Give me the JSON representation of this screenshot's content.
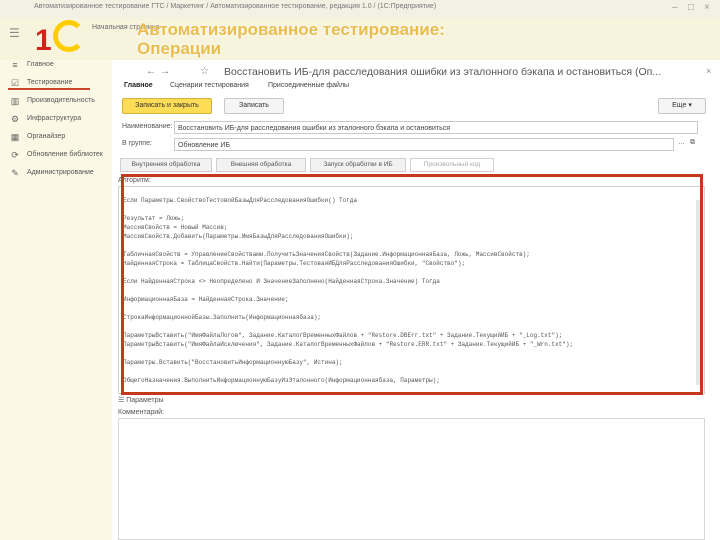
{
  "window": {
    "title": "Автоматизированное тестирование ГТС / Маркетинг / Автоматизированное тестирование, редакция 1.0 / (1С:Предприятие)"
  },
  "header": {
    "breadcrumb": "Начальная страница",
    "overlay_title_line1": "Автоматизированное тестирование:",
    "overlay_title_line2": "Операции"
  },
  "sidebar": {
    "items": [
      {
        "label": "Главное",
        "icon": "list-icon"
      },
      {
        "label": "Тестирование",
        "icon": "checklist-icon"
      },
      {
        "label": "Производительность",
        "icon": "chart-icon"
      },
      {
        "label": "Инфраструктура",
        "icon": "gear-icon"
      },
      {
        "label": "Органайзер",
        "icon": "calendar-icon"
      },
      {
        "label": "Обновление библиотек",
        "icon": "refresh-icon"
      },
      {
        "label": "Администрирование",
        "icon": "wrench-icon"
      }
    ]
  },
  "form": {
    "title": "Восстановить ИБ-для расследования ошибки из эталонного бэкапа и остановиться (Оп...",
    "tabs": [
      "Главное",
      "Сценарии тестирования",
      "Присоединенные файлы"
    ],
    "save_close_label": "Записать и закрыть",
    "save_label": "Записать",
    "more_label": "Еще",
    "name_label": "Наименование:",
    "name_value": "Восстановить ИБ-для расследования ошибки из эталонного бэкапа и остановиться",
    "group_label": "В группе:",
    "group_value": "Обновление ИБ",
    "subtabs": [
      "Внутренняя обработка",
      "Внешняя обработка",
      "Запуск обработки в ИБ",
      "Произвольный код"
    ],
    "algorithm_label": "Алгоритм:",
    "code_lines": [
      "Если Параметры.СвойствоТестовойБазыДляРасследованияОшибки() Тогда",
      "",
      "    Результат = Ложь;",
      "    МассивСвойств = Новый Массив;",
      "    МассивСвойств.Добавить(Параметры.ИмяБазыДляРасследованияОшибки);",
      "",
      "    ТабличнаяСвойств = УправлениеСвойствами.ПолучитьЗначенияСвойств(Задание.ИнформационнаяБаза, Ложь, МассивСвойств);",
      "    НайденнаяСтрока = ТаблицаСвойств.Найти(Параметры.ТестоваяИБДляРасследованияОшибки, \"Свойство\");",
      "",
      "    Если НайденнаяСтрока <> Неопределено И ЗначениеЗаполнено(НайденнаяСтрока.Значение) Тогда",
      "",
      "        ИнформационнаяБаза = НайденнаяСтрока.Значение;",
      "",
      "        СтрокаИнформационнойБазы.Заполнить(Информационнаябаза);",
      "",
      "        ПараметрыВставить(\"ИмяФайлаЛогов\",            Задание.КаталогВременныхФайлов + \"Restore.DBErr.txt\" + Задание.ТекущийИБ + \"_Log.txt\");",
      "        ПараметрыВставить(\"ИмяФайлаИсключения\",       Задание.КаталогВременныхФайлов + \"Restore.ERR.txt\" + Задание.ТекущийИБ + \"_Wrn.txt\");",
      "",
      "        Параметры.Вставить(\"ВосстановитьИнформационнуюБазу\",      Истина);",
      "",
      "        ОбщегоНазначения.ВыполнитьИнформационнуюБазуИзЭталонного(Информационнаябаза, Параметры);"
    ],
    "bottom_label": "Параметры",
    "comment_label": "Комментарий:"
  },
  "colors": {
    "brand_red": "#d3231b",
    "brand_yellow": "#ffcc00",
    "highlight_border": "#c4391d",
    "primary_button": "#fddc56"
  }
}
